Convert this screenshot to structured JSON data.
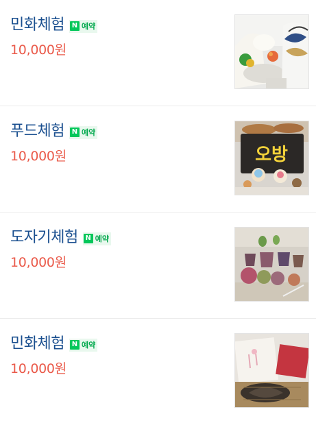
{
  "items": [
    {
      "title": "민화체험",
      "badge": {
        "icon": "N",
        "label": "예약"
      },
      "price": "10,000원",
      "photo_label": "",
      "photo_type": "minhwa-craft"
    },
    {
      "title": "푸드체험",
      "badge": {
        "icon": "N",
        "label": "예약"
      },
      "price": "10,000원",
      "photo_label": "오방",
      "photo_type": "food-craft"
    },
    {
      "title": "도자기체험",
      "badge": {
        "icon": "N",
        "label": "예약"
      },
      "price": "10,000원",
      "photo_label": "",
      "photo_type": "pottery-craft"
    },
    {
      "title": "민화체험",
      "badge": {
        "icon": "N",
        "label": "예약"
      },
      "price": "10,000원",
      "photo_label": "",
      "photo_type": "minhwa-book"
    }
  ],
  "colors": {
    "title": "#1a4f8f",
    "price": "#ea5a4a",
    "naver_green": "#03c75a"
  }
}
